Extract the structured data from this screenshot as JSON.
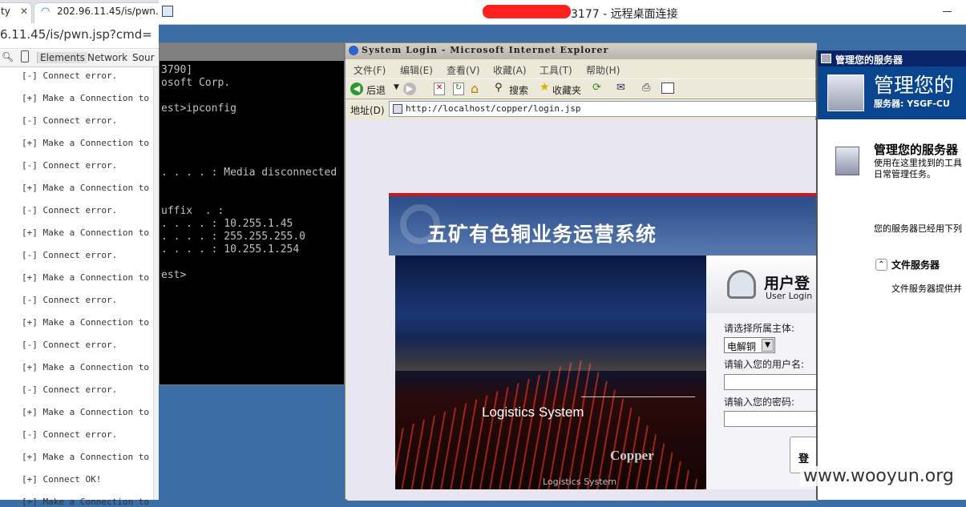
{
  "browser": {
    "tab_partial": "ty",
    "tab_url": "202.96.11.45/is/pwn.",
    "address": "6.11.45/is/pwn.jsp?cmd=",
    "devtools_tabs": [
      "Elements",
      "Network",
      "Sour"
    ]
  },
  "console_lines": [
    "[-] Connect error.",
    "[+] Make a Connection to",
    "[-] Connect error.",
    "[+] Make a Connection to",
    "[-] Connect error.",
    "[+] Make a Connection to",
    "[-] Connect error.",
    "[+] Make a Connection to",
    "[-] Connect error.",
    "[+] Make a Connection to",
    "[-] Connect error.",
    "[+] Make a Connection to",
    "[-] Connect error.",
    "[+] Make a Connection to",
    "[-] Connect error.",
    "[+] Make a Connection to",
    "[-] Connect error.",
    "[+] Make a Connection to",
    "[+] Connect OK!",
    "[+] Make a Connection to"
  ],
  "rdp": {
    "title_suffix": "3177 - 远程桌面连接"
  },
  "cmd_lines": [
    "3790]",
    "osoft Corp.",
    "",
    "est>ipconfig",
    "",
    "",
    "",
    "",
    ". . . . : Media disconnected",
    "",
    "",
    "uffix  . :",
    ". . . . : 10.255.1.45",
    ". . . . : 255.255.255.0",
    ". . . . : 10.255.1.254",
    "",
    "est>"
  ],
  "ie": {
    "title": "System Login - Microsoft Internet Explorer",
    "menu": [
      "文件(F)",
      "编辑(E)",
      "查看(V)",
      "收藏(A)",
      "工具(T)",
      "帮助(H)"
    ],
    "toolbar": {
      "back": "后退",
      "search": "搜索",
      "favorites": "收藏夹"
    },
    "address_label": "地址(D)",
    "url": "http://localhost/copper/login.jsp"
  },
  "login": {
    "banner_title": "五矿有色铜业务运营系统",
    "photo_text": "Logistics System",
    "photo_logo": "Copper",
    "photo_subtext": "Logistics System",
    "header_cn": "用户登",
    "header_en": "User Login",
    "entity_label": "请选择所属主体:",
    "entity_value": "电解铜",
    "username_label": "请输入您的用户名:",
    "password_label": "请输入您的密码:",
    "submit": "登"
  },
  "server_manager": {
    "title": "管理您的服务器",
    "header_big": "管理您的",
    "server_label": "服务器: YSGF-CU",
    "section_title": "管理您的服务器",
    "section_desc1": "使用在这里找到的工具",
    "section_desc2": "日常管理任务。",
    "roles_text": "您的服务器已经用下列",
    "role_name": "文件服务器",
    "role_desc": "文件服务器提供并"
  },
  "watermark": "www.wooyun.org"
}
